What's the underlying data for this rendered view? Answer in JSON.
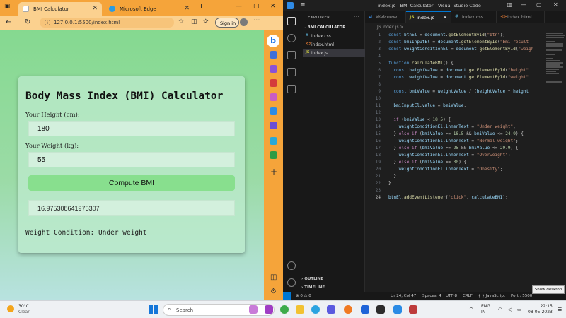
{
  "browser": {
    "tabs": [
      {
        "label": "BMI Calculator",
        "active": true
      },
      {
        "label": "Microsoft Edge",
        "active": false
      }
    ],
    "new_tab_label": "+",
    "url": "127.0.0.1:5500/index.html",
    "signin_label": "Sign in",
    "window_controls": [
      "—",
      "▢",
      "✕"
    ],
    "accent_color": "#f5a43a"
  },
  "bmi_app": {
    "title": "Body Mass Index (BMI) Calculator",
    "height_label": "Your Height (cm):",
    "height_value": "180",
    "weight_label": "Your Weight (kg):",
    "weight_value": "55",
    "compute_label": "Compute BMI",
    "result_value": "16.975308641975307",
    "condition_text": "Weight Condition: Under weight"
  },
  "vscode": {
    "window_title": "index.js - BMI Calculator - Visual Studio Code",
    "menu_icon": "≡",
    "explorer_title": "EXPLORER",
    "explorer_more": "···",
    "folder_name": "BMI CALCULATOR",
    "files": [
      {
        "name": "index.css",
        "icon": "#",
        "selected": false
      },
      {
        "name": "index.html",
        "icon": "<>",
        "selected": false
      },
      {
        "name": "index.js",
        "icon": "JS",
        "selected": true
      }
    ],
    "outline_label": "OUTLINE",
    "timeline_label": "TIMELINE",
    "tabs": [
      {
        "label": "Welcome",
        "icon": "✕"
      },
      {
        "label": "index.js",
        "icon": "JS"
      },
      {
        "label": "index.css",
        "icon": "#"
      },
      {
        "label": "index.html",
        "icon": "<>"
      }
    ],
    "breadcrumb": "JS  index.js > ...",
    "line_numbers": [
      "1",
      "2",
      "3",
      "4",
      "5",
      "6",
      "7",
      "8",
      "9",
      "10",
      "11",
      "12",
      "13",
      "14",
      "15",
      "16",
      "17",
      "18",
      "19",
      "20",
      "21",
      "22",
      "23",
      "24"
    ],
    "current_line": 24,
    "status": {
      "problems": "⊗ 0 ⚠ 0",
      "position": "Ln 24, Col 47",
      "spaces": "Spaces: 4",
      "encoding": "UTF-8",
      "eol": "CRLF",
      "language": "{ } JavaScript",
      "port": "Port : 5500"
    },
    "tooltip": "Show desktop"
  },
  "taskbar": {
    "temperature": "30°C",
    "weather_condition": "Clear",
    "search_label": "Search",
    "lang_top": "ENG",
    "lang_bottom": "IN",
    "time": "22:15",
    "date": "08-05-2023",
    "start_color": "#1677d9"
  }
}
